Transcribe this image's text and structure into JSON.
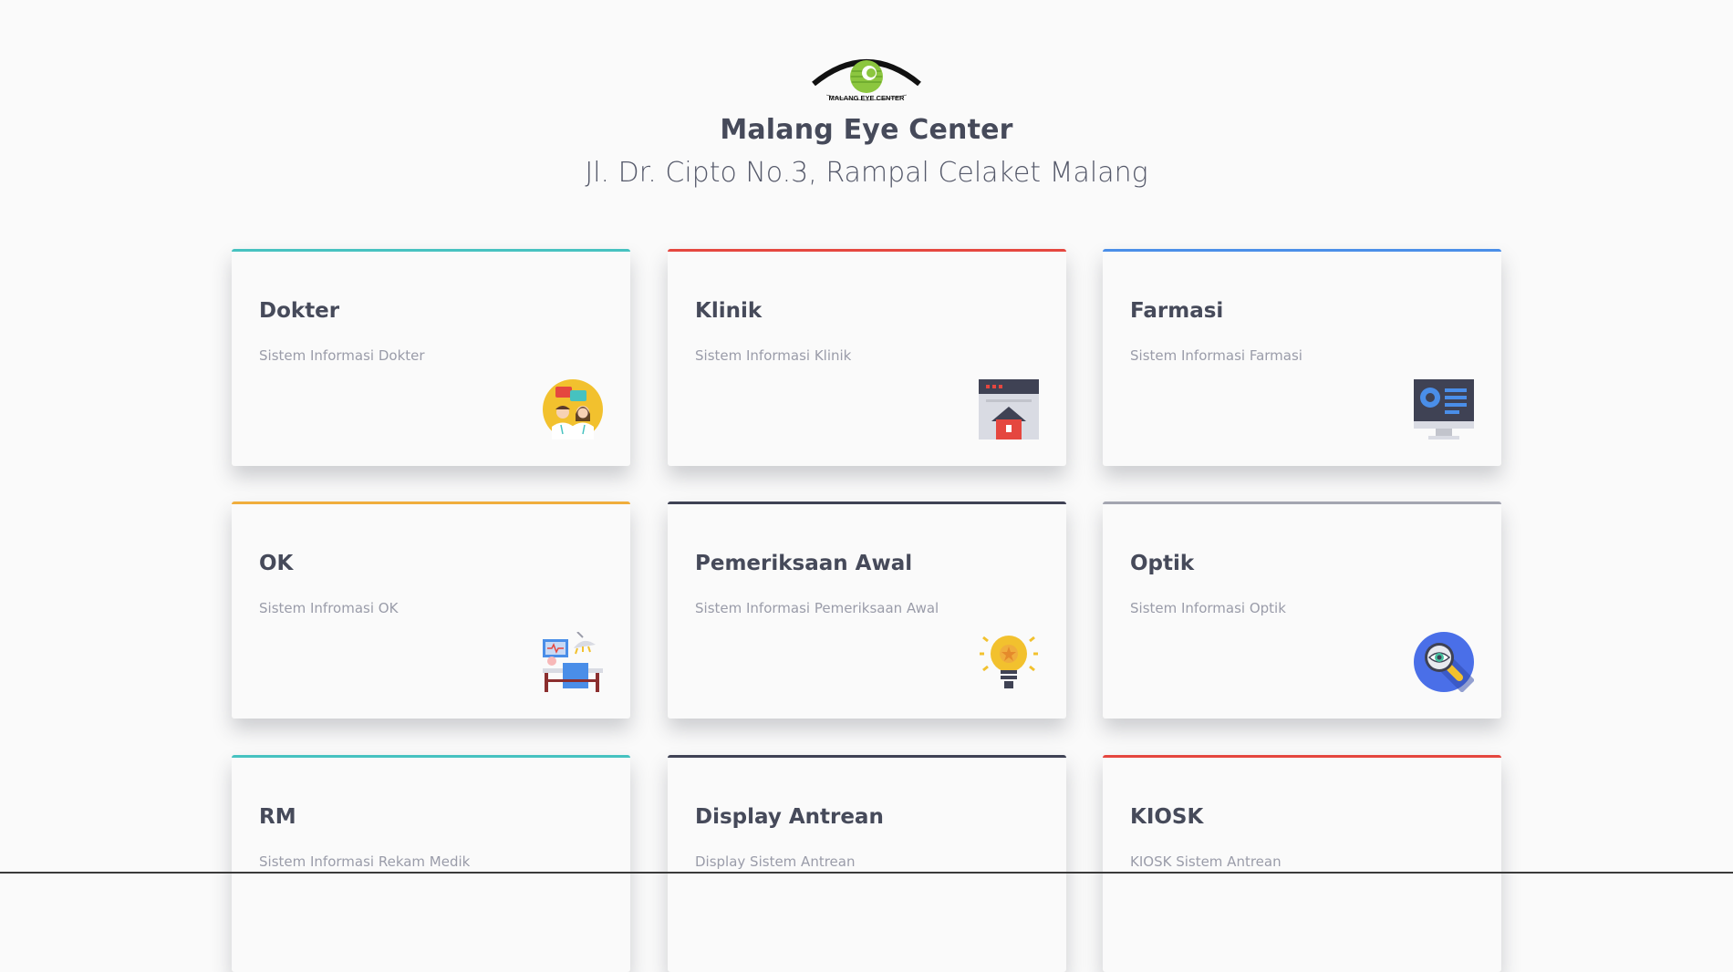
{
  "header": {
    "org_name": "Malang Eye Center",
    "address": "Jl. Dr. Cipto No.3, Rampal Celaket Malang",
    "logo_text": "MALANG EYE CENTER"
  },
  "cards": [
    {
      "title": "Dokter",
      "desc": "Sistem Informasi Dokter",
      "accent": "#46c2c0",
      "icon": "doctors-icon"
    },
    {
      "title": "Klinik",
      "desc": "Sistem Informasi Klinik",
      "accent": "#e5473f",
      "icon": "clinic-icon"
    },
    {
      "title": "Farmasi",
      "desc": "Sistem Informasi Farmasi",
      "accent": "#4a8ee8",
      "icon": "monitor-icon"
    },
    {
      "title": "OK",
      "desc": "Sistem Infromasi OK",
      "accent": "#f0ad3c",
      "icon": "operating-room-icon"
    },
    {
      "title": "Pemeriksaan Awal",
      "desc": "Sistem Informasi Pemeriksaan Awal",
      "accent": "#3f4254",
      "icon": "lightbulb-icon"
    },
    {
      "title": "Optik",
      "desc": "Sistem Informasi Optik",
      "accent": "#a3a5b0",
      "icon": "magnifier-eye-icon"
    },
    {
      "title": "RM",
      "desc": "Sistem Informasi Rekam Medik",
      "accent": "#46c2c0",
      "icon": ""
    },
    {
      "title": "Display Antrean",
      "desc": "Display Sistem Antrean",
      "accent": "#3f4254",
      "icon": ""
    },
    {
      "title": "KIOSK",
      "desc": "KIOSK Sistem Antrean",
      "accent": "#e5473f",
      "icon": ""
    }
  ]
}
